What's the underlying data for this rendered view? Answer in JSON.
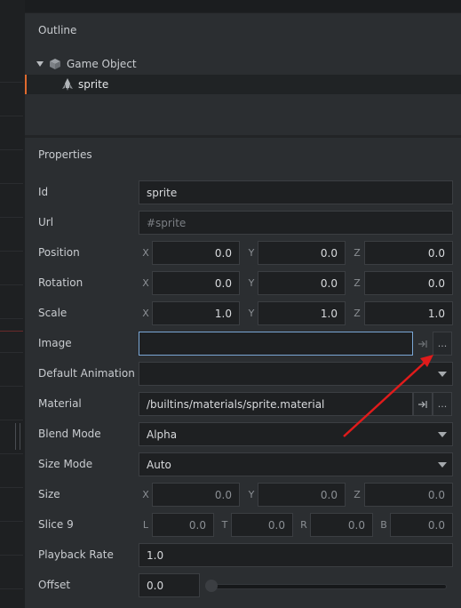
{
  "outline": {
    "title": "Outline",
    "items": [
      {
        "label": "Game Object",
        "icon": "cube-icon",
        "expanded": true
      },
      {
        "label": "sprite",
        "icon": "sprite-icon",
        "selected": true
      }
    ]
  },
  "properties": {
    "title": "Properties",
    "id": {
      "label": "Id",
      "value": "sprite"
    },
    "url": {
      "label": "Url",
      "placeholder": "#sprite"
    },
    "position": {
      "label": "Position",
      "x_axis": "X",
      "y_axis": "Y",
      "z_axis": "Z",
      "x": "0.0",
      "y": "0.0",
      "z": "0.0"
    },
    "rotation": {
      "label": "Rotation",
      "x_axis": "X",
      "y_axis": "Y",
      "z_axis": "Z",
      "x": "0.0",
      "y": "0.0",
      "z": "0.0"
    },
    "scale": {
      "label": "Scale",
      "x_axis": "X",
      "y_axis": "Y",
      "z_axis": "Z",
      "x": "1.0",
      "y": "1.0",
      "z": "1.0"
    },
    "image": {
      "label": "Image",
      "value": "",
      "jump_icon": "go-to-icon",
      "browse_label": "..."
    },
    "default_animation": {
      "label": "Default Animation",
      "value": ""
    },
    "material": {
      "label": "Material",
      "value": "/builtins/materials/sprite.material",
      "jump_icon": "go-to-icon",
      "browse_label": "..."
    },
    "blend_mode": {
      "label": "Blend Mode",
      "value": "Alpha"
    },
    "size_mode": {
      "label": "Size Mode",
      "value": "Auto"
    },
    "size": {
      "label": "Size",
      "x_axis": "X",
      "y_axis": "Y",
      "z_axis": "Z",
      "x": "0.0",
      "y": "0.0",
      "z": "0.0"
    },
    "slice9": {
      "label": "Slice 9",
      "l_axis": "L",
      "t_axis": "T",
      "r_axis": "R",
      "b_axis": "B",
      "l": "0.0",
      "t": "0.0",
      "r": "0.0",
      "b": "0.0"
    },
    "playback_rate": {
      "label": "Playback Rate",
      "value": "1.0"
    },
    "offset": {
      "label": "Offset",
      "value": "0.0",
      "slider_fraction": 0.0
    }
  },
  "colors": {
    "accent_selected": "#e06a2e",
    "focus_border": "#7aa7d6",
    "annotation_arrow": "#e01b1b"
  }
}
